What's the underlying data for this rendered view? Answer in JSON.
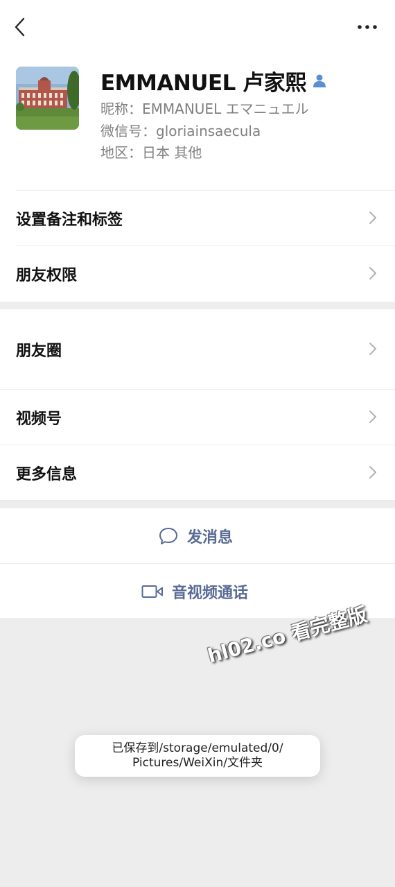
{
  "profile": {
    "display_name": "EMMANUEL 卢家熙",
    "nickname_line": "昵称：EMMANUEL エマニュエル",
    "wechat_id_line": "微信号：gloriainsaecula",
    "region_line": "地区：日本  其他"
  },
  "menu": {
    "remark_tags": "设置备注和标签",
    "permissions": "朋友权限",
    "moments": "朋友圈",
    "channels": "视频号",
    "more_info": "更多信息"
  },
  "actions": {
    "send_message": "发消息",
    "video_call": "音视频通话"
  },
  "watermark": "hl02.co 看完整版",
  "toast": {
    "line1": "已保存到/storage/emulated/0/",
    "line2": "Pictures/WeiXin/文件夹"
  },
  "colors": {
    "link": "#576b95",
    "verified_icon": "#5a8fd6",
    "background": "#ededed"
  }
}
